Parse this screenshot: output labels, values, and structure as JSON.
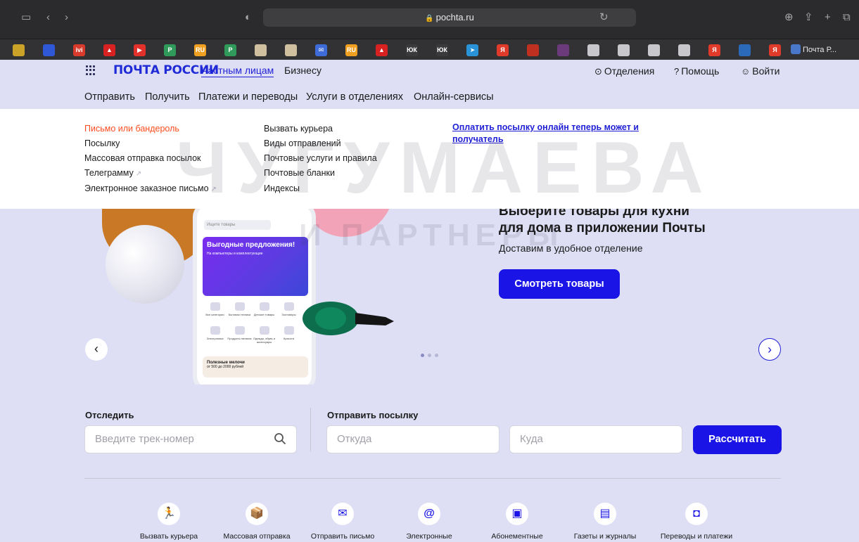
{
  "browser": {
    "url": "pochta.ru",
    "last_bookmark": "Почта Р..."
  },
  "bookmarks": [
    {
      "label": "",
      "color": "#c9a227"
    },
    {
      "label": "",
      "color": "#2f58d6"
    },
    {
      "label": "ivi",
      "color": "#d83a2b"
    },
    {
      "label": "▲",
      "color": "#d82222"
    },
    {
      "label": "▶",
      "color": "#e2302a"
    },
    {
      "label": "P",
      "color": "#2f9a5a"
    },
    {
      "label": "RU",
      "color": "#f0a020"
    },
    {
      "label": "P",
      "color": "#2f9a5a"
    },
    {
      "label": "",
      "color": "#d0c0a0"
    },
    {
      "label": "",
      "color": "#d0c0a0"
    },
    {
      "label": "✉",
      "color": "#3d6bd8"
    },
    {
      "label": "RU",
      "color": "#f0a020"
    },
    {
      "label": "▲",
      "color": "#d82222"
    },
    {
      "label": "ЮК",
      "color": "#3a3a3c"
    },
    {
      "label": "ЮК",
      "color": "#3a3a3c"
    },
    {
      "label": "➤",
      "color": "#2a93d8"
    },
    {
      "label": "Я",
      "color": "#e03a2a"
    },
    {
      "label": "",
      "color": "#c03020"
    },
    {
      "label": "",
      "color": "#6a3a7a"
    },
    {
      "label": "",
      "color": "#c8c8cc"
    },
    {
      "label": "",
      "color": "#c8c8cc"
    },
    {
      "label": "",
      "color": "#c8c8cc"
    },
    {
      "label": "",
      "color": "#c8c8cc"
    },
    {
      "label": "Я",
      "color": "#e03a2a"
    },
    {
      "label": "",
      "color": "#2a6ab8"
    },
    {
      "label": "Я",
      "color": "#e03a2a"
    }
  ],
  "header": {
    "logo": "ПОЧТА РОССИИ",
    "nav_private": "Частным лицам",
    "nav_business": "Бизнесу",
    "offices": "Отделения",
    "help": "Помощь",
    "login": "Войти"
  },
  "main_menu": [
    "Отправить",
    "Получить",
    "Платежи и переводы",
    "Услуги в отделениях",
    "Онлайн-сервисы"
  ],
  "dropdown": {
    "col1": [
      "Письмо или бандероль",
      "Посылку",
      "Массовая отправка посылок",
      "Телеграмму",
      "Электронное заказное письмо"
    ],
    "col2": [
      "Вызвать курьера",
      "Виды отправлений",
      "Почтовые услуги и правила",
      "Почтовые бланки",
      "Индексы"
    ],
    "promo": "Оплатить посылку онлайн теперь может и получатель"
  },
  "hero": {
    "title_line1": "Выберите товары для кухни",
    "title_line2": "для дома в приложении Почты",
    "subtitle": "Доставим в удобное отделение",
    "button": "Смотреть товары",
    "phone_search": "Ищите товары",
    "phone_promo": "Выгодные предложения!",
    "phone_promo_sub": "На компьютеры и комплектующие",
    "phone_bottom": "Полезные мелочи",
    "phone_bottom_sub": "от 500 до 2000 рублей",
    "phone_categories": [
      "Все категории",
      "Бытовая техника",
      "Детские товары",
      "Зоотовары",
      "Электроника",
      "Продукты питания",
      "Одежда, обувь и аксессуары",
      "Красота"
    ]
  },
  "track": {
    "label": "Отследить",
    "placeholder": "Введите трек-номер"
  },
  "send": {
    "label": "Отправить посылку",
    "from_placeholder": "Откуда",
    "to_placeholder": "Куда",
    "button": "Рассчитать"
  },
  "services": [
    {
      "icon": "courier-icon",
      "glyph": "🏃",
      "label": "Вызвать курьера"
    },
    {
      "icon": "mass-send-icon",
      "glyph": "📦",
      "label": "Массовая отправка"
    },
    {
      "icon": "letter-icon",
      "glyph": "✉",
      "label": "Отправить письмо"
    },
    {
      "icon": "email-icon",
      "glyph": "@",
      "label": "Электронные"
    },
    {
      "icon": "subscription-box-icon",
      "glyph": "▣",
      "label": "Абонементные"
    },
    {
      "icon": "newspaper-icon",
      "glyph": "▤",
      "label": "Газеты и журналы"
    },
    {
      "icon": "wallet-icon",
      "glyph": "◘",
      "label": "Переводы и платежи"
    }
  ],
  "watermark": {
    "line1": "ЧУГУМАЕВА",
    "line2": "И ПАРТНЕРЫ"
  },
  "colors": {
    "accent": "#1a15e6",
    "highlight": "#ff4b1f",
    "page_bg": "#dedff4"
  }
}
